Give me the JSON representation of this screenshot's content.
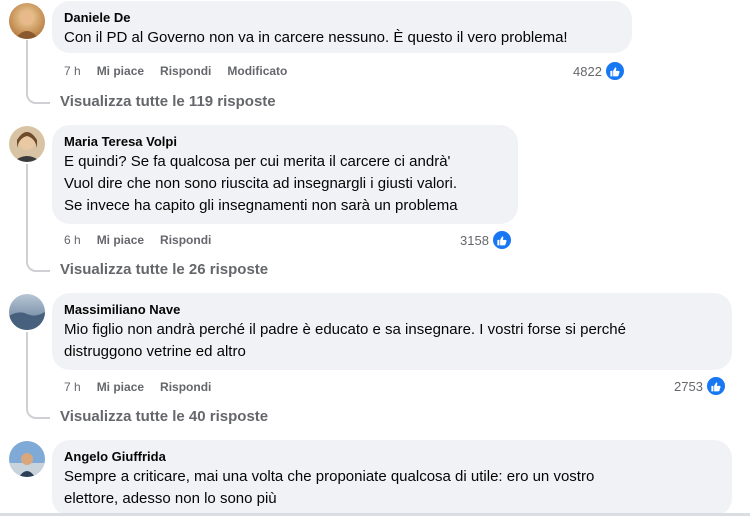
{
  "comments": [
    {
      "author": "Daniele De",
      "lines": [
        "Con il PD al Governo non va in carcere nessuno. È questo il vero problema!"
      ],
      "time": "7 h",
      "like_label": "Mi piace",
      "reply_label": "Rispondi",
      "edited_label": "Modificato",
      "likes": "4822",
      "view_replies": "Visualizza tutte le 119 risposte"
    },
    {
      "author": "Maria Teresa Volpi",
      "lines": [
        "E quindi? Se fa qualcosa per cui merita il carcere ci andrà'",
        "Vuol dire che non sono riuscita ad insegnargli i giusti valori.",
        "Se invece ha capito gli insegnamenti non sarà un problema"
      ],
      "time": "6 h",
      "like_label": "Mi piace",
      "reply_label": "Rispondi",
      "likes": "3158",
      "view_replies": "Visualizza tutte le 26 risposte"
    },
    {
      "author": "Massimiliano Nave",
      "lines": [
        "Mio figlio non andrà perché il padre è educato e sa insegnare. I vostri forse si perché",
        "distruggono vetrine ed altro"
      ],
      "time": "7 h",
      "like_label": "Mi piace",
      "reply_label": "Rispondi",
      "likes": "2753",
      "view_replies": "Visualizza tutte le 40 risposte"
    },
    {
      "author": "Angelo Giuffrida",
      "lines": [
        "Sempre a criticare, mai una volta che proponiate qualcosa di utile: ero un vostro",
        "elettore, adesso non lo sono più"
      ]
    }
  ],
  "colors": {
    "bubble": "#f0f2f5",
    "meta_text": "#65676b",
    "like_blue": "#1877f2",
    "thread_line": "#ced0d4"
  },
  "icons": {
    "like": "thumbs-up-icon"
  }
}
